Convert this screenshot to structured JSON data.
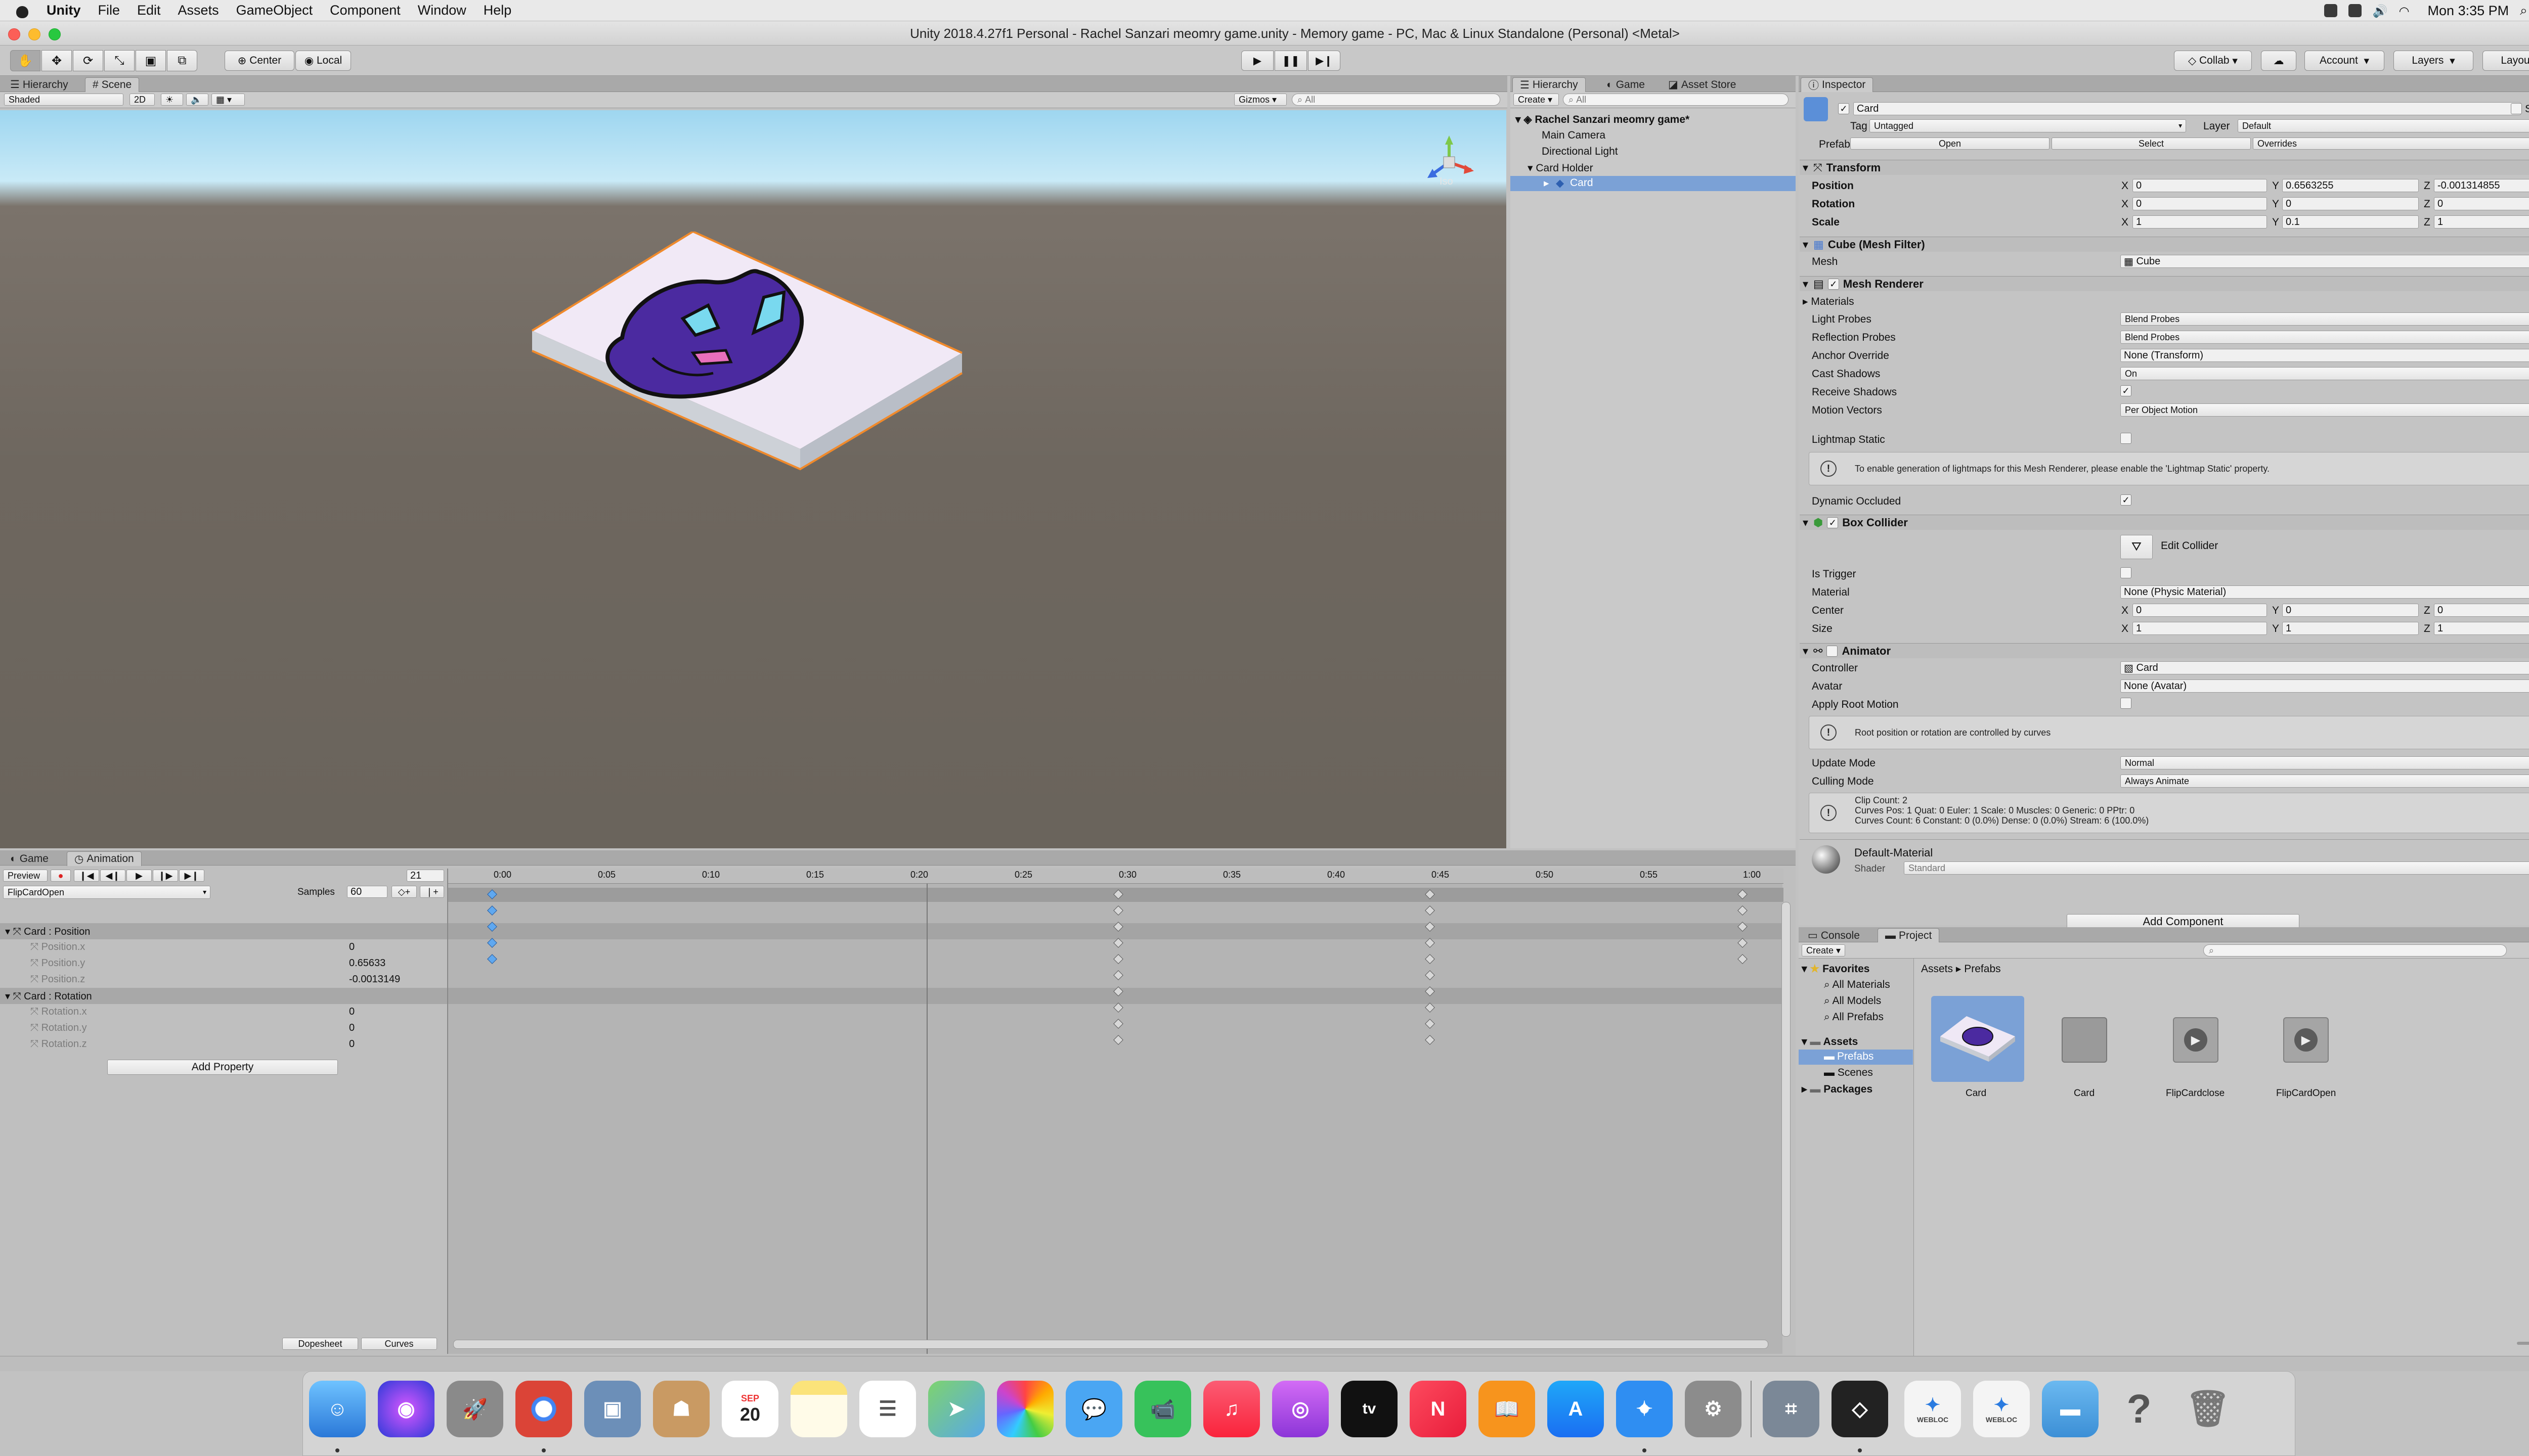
{
  "menubar": {
    "app": "Unity",
    "items": [
      "File",
      "Edit",
      "Assets",
      "GameObject",
      "Component",
      "Window",
      "Help"
    ],
    "clock": "Mon 3:35 PM"
  },
  "window": {
    "title": "Unity 2018.4.27f1 Personal - Rachel Sanzari meomry game.unity - Memory game - PC, Mac & Linux Standalone (Personal) <Metal>"
  },
  "toolbar": {
    "pivot": "Center",
    "space": "Local",
    "collab": "Collab",
    "account": "Account",
    "layers": "Layers",
    "layout": "Layout"
  },
  "scene_panel": {
    "tabs": [
      "Hierarchy",
      "Scene"
    ],
    "shading": "Shaded",
    "mode_2d": "2D",
    "gizmos": "Gizmos",
    "search_placeholder": "All",
    "projection": "Iso"
  },
  "hierarchy": {
    "tabs": [
      "Hierarchy",
      "Game",
      "Asset Store"
    ],
    "create": "Create",
    "search_placeholder": "All",
    "scene": "Rachel Sanzari meomry game*",
    "items": [
      "Main Camera",
      "Directional Light",
      "Card Holder",
      "Card"
    ]
  },
  "inspector": {
    "tab": "Inspector",
    "object_name": "Card",
    "static": "Static",
    "tag_label": "Tag",
    "tag": "Untagged",
    "layer_label": "Layer",
    "layer": "Default",
    "prefab_label": "Prefab",
    "prefab_open": "Open",
    "prefab_select": "Select",
    "prefab_overrides": "Overrides",
    "transform": {
      "title": "Transform",
      "position_label": "Position",
      "pos_x": "0",
      "pos_y": "0.6563255",
      "pos_z": "-0.001314855",
      "rotation_label": "Rotation",
      "rot_x": "0",
      "rot_y": "0",
      "rot_z": "0",
      "scale_label": "Scale",
      "scl_x": "1",
      "scl_y": "0.1",
      "scl_z": "1"
    },
    "mesh_filter": {
      "title": "Cube (Mesh Filter)",
      "mesh_label": "Mesh",
      "mesh": "Cube"
    },
    "mesh_renderer": {
      "title": "Mesh Renderer",
      "materials": "Materials",
      "light_probes_label": "Light Probes",
      "light_probes": "Blend Probes",
      "reflection_label": "Reflection Probes",
      "reflection": "Blend Probes",
      "anchor_label": "Anchor Override",
      "anchor": "None (Transform)",
      "cast_label": "Cast Shadows",
      "cast": "On",
      "receive_label": "Receive Shadows",
      "motion_label": "Motion Vectors",
      "motion": "Per Object Motion",
      "lightmap_label": "Lightmap Static",
      "lightmap_help": "To enable generation of lightmaps for this Mesh Renderer, please enable the 'Lightmap Static' property.",
      "occluded_label": "Dynamic Occluded"
    },
    "box_collider": {
      "title": "Box Collider",
      "edit": "Edit Collider",
      "trigger_label": "Is Trigger",
      "material_label": "Material",
      "material": "None (Physic Material)",
      "center_label": "Center",
      "c_x": "0",
      "c_y": "0",
      "c_z": "0",
      "size_label": "Size",
      "s_x": "1",
      "s_y": "1",
      "s_z": "1"
    },
    "animator": {
      "title": "Animator",
      "controller_label": "Controller",
      "controller": "Card",
      "avatar_label": "Avatar",
      "avatar": "None (Avatar)",
      "root_label": "Apply Root Motion",
      "root_help": "Root position or rotation are controlled by curves",
      "update_label": "Update Mode",
      "update": "Normal",
      "culling_label": "Culling Mode",
      "culling": "Always Animate",
      "clip_line1": "Clip Count: 2",
      "clip_line2": "Curves Pos: 1 Quat: 0 Euler: 1 Scale: 0 Muscles: 0 Generic: 0 PPtr: 0",
      "clip_line3": "Curves Count: 6 Constant: 0 (0.0%) Dense: 0 (0.0%) Stream: 6 (100.0%)"
    },
    "material": {
      "name": "Default-Material",
      "shader_label": "Shader",
      "shader": "Standard"
    },
    "add_component": "Add Component"
  },
  "animation": {
    "tabs": [
      "Game",
      "Animation"
    ],
    "preview": "Preview",
    "frame": "21",
    "clip": "FlipCardOpen",
    "samples_label": "Samples",
    "samples": "60",
    "timeline": [
      "0:00",
      "0:05",
      "0:10",
      "0:15",
      "0:20",
      "0:25",
      "0:30",
      "0:35",
      "0:40",
      "0:45",
      "0:50",
      "0:55",
      "1:00"
    ],
    "groups": [
      {
        "name": "Card : Position",
        "props": [
          {
            "name": "Position.x",
            "value": "0"
          },
          {
            "name": "Position.y",
            "value": "0.65633"
          },
          {
            "name": "Position.z",
            "value": "-0.0013149"
          }
        ]
      },
      {
        "name": "Card : Rotation",
        "props": [
          {
            "name": "Rotation.x",
            "value": "0"
          },
          {
            "name": "Rotation.y",
            "value": "0"
          },
          {
            "name": "Rotation.z",
            "value": "0"
          }
        ]
      }
    ],
    "add_property": "Add Property",
    "dopesheet": "Dopesheet",
    "curves": "Curves"
  },
  "project": {
    "tabs": [
      "Console",
      "Project"
    ],
    "create": "Create",
    "favorites": "Favorites",
    "fav_items": [
      "All Materials",
      "All Models",
      "All Prefabs"
    ],
    "assets": "Assets",
    "asset_items": [
      "Prefabs",
      "Scenes"
    ],
    "packages": "Packages",
    "breadcrumb": [
      "Assets",
      "Prefabs"
    ],
    "files": [
      "Card",
      "Card",
      "FlipCardclose",
      "FlipCardOpen"
    ]
  },
  "dock": {
    "calendar_month": "SEP",
    "calendar_day": "20",
    "webloc": "WEBLOC",
    "apps": [
      "Finder",
      "Siri",
      "Launchpad",
      "Chrome",
      "Preview",
      "Contacts",
      "Calendar",
      "Notes",
      "Reminders",
      "Maps",
      "Photos",
      "Messages",
      "FaceTime",
      "Music",
      "Podcasts",
      "TV",
      "News",
      "Books",
      "App Store",
      "Safari",
      "System Preferences",
      "Screenshot",
      "Unity",
      "Webloc 1",
      "Webloc 2",
      "Folder",
      "Help",
      "Trash"
    ]
  }
}
